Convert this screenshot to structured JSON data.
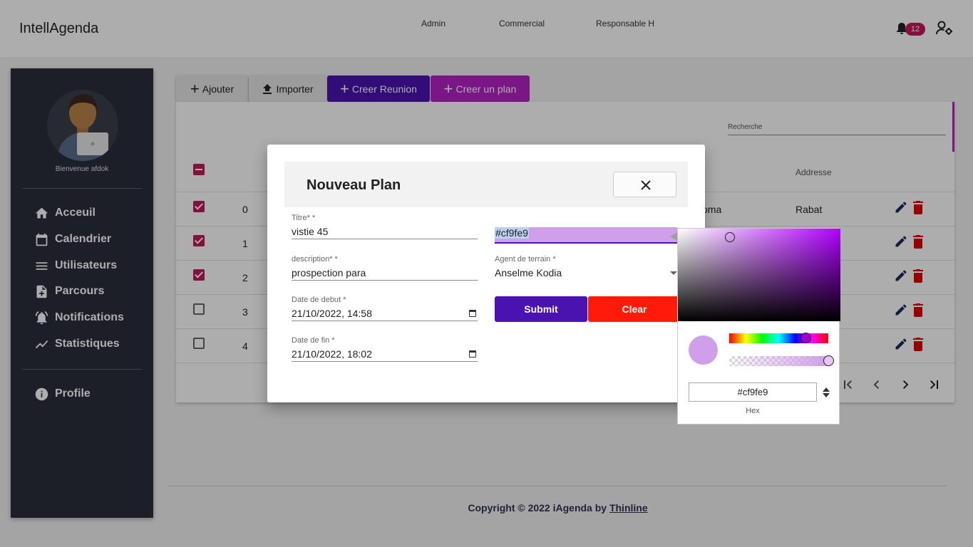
{
  "app": {
    "title": "IntellAgenda"
  },
  "topnav": {
    "items": [
      "Admin",
      "Commercial",
      "Responsable H"
    ],
    "notifications_count": "12"
  },
  "sidebar": {
    "welcome": "Bienvenue afdok",
    "items": [
      {
        "label": "Acceuil",
        "icon": "home-icon"
      },
      {
        "label": "Calendrier",
        "icon": "calendar-icon"
      },
      {
        "label": "Utilisateurs",
        "icon": "menu-icon"
      },
      {
        "label": "Parcours",
        "icon": "file-add-icon"
      },
      {
        "label": "Notifications",
        "icon": "bell-icon"
      },
      {
        "label": "Statistiques",
        "icon": "chart-line-icon"
      }
    ],
    "profile": "Profile"
  },
  "toolbar": {
    "add": "Ajouter",
    "import": "Importer",
    "create_meeting": "Creer Reunion",
    "create_plan": "Creer un plan"
  },
  "table": {
    "search_label": "Recherche",
    "col_address": "Addresse",
    "rows": [
      {
        "index": "0",
        "checked": true,
        "partial_text": "oma",
        "address": "Rabat"
      },
      {
        "index": "1",
        "checked": true
      },
      {
        "index": "2",
        "checked": true
      },
      {
        "index": "3",
        "checked": false
      },
      {
        "index": "4",
        "checked": false
      }
    ]
  },
  "footer": {
    "text": "Copyright © 2022 iAgenda by ",
    "link": "Thinline"
  },
  "dialog": {
    "title": "Nouveau Plan",
    "fields": {
      "titre": {
        "label": "Titre* *",
        "value": "vistie 45"
      },
      "description": {
        "label": "description* *",
        "value": "prospection para"
      },
      "date_debut": {
        "label": "Date de debut *",
        "value": "21/10/2022, 14:58"
      },
      "date_fin": {
        "label": "Date de fin *",
        "value": "21/10/2022, 18:02"
      },
      "color": {
        "value": "#cf9fe9"
      },
      "agent": {
        "label": "Agent de terrain *",
        "value": "Anselme Kodia"
      }
    },
    "submit": "Submit",
    "clear": "Clear"
  },
  "color_picker": {
    "hex": "#cf9fe9",
    "mode_label": "Hex",
    "color": "#cf9fe9"
  },
  "colors": {
    "primary": "#4a13b0",
    "accent": "#b521c8",
    "danger": "#ff1a0a",
    "pink": "#c2185b",
    "sidebar": "#2b2f3b"
  }
}
